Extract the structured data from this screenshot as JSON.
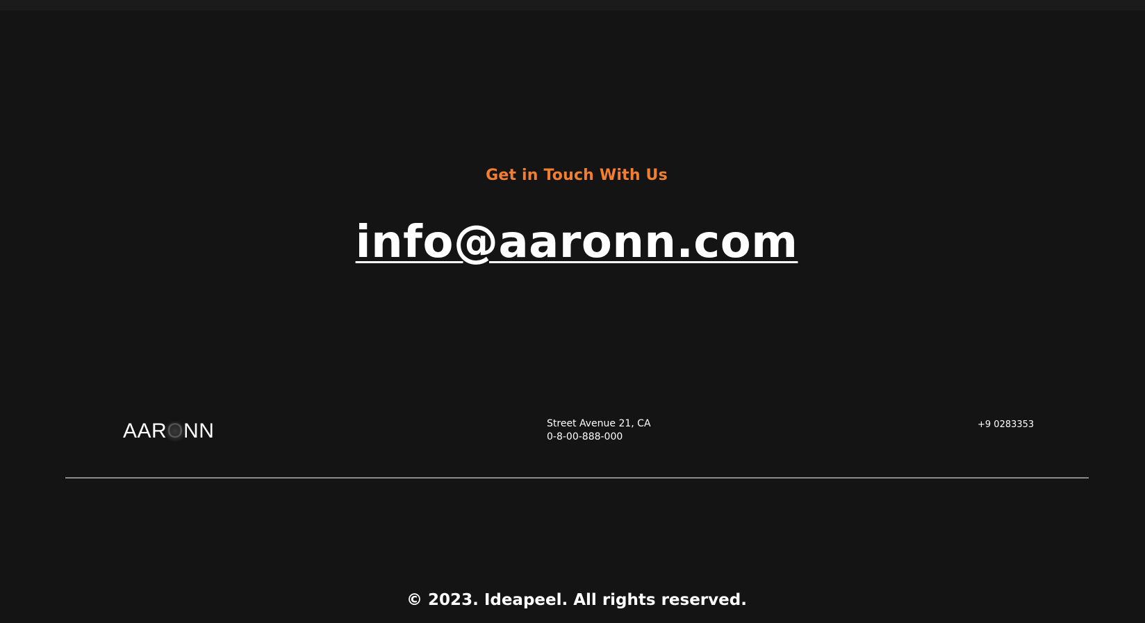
{
  "contact": {
    "heading": "Get in Touch With Us",
    "email": "info@aaronn.com"
  },
  "footer": {
    "logo": {
      "part1": "AAR",
      "part2": "O",
      "part3": "NN"
    },
    "address_line1": "Street Avenue 21, CA",
    "address_line2": "0-8-00-888-000",
    "phone": "+9 0283353",
    "copyright": "© 2023. Ideapeel. All rights reserved."
  },
  "colors": {
    "background": "#141414",
    "accent": "#f27f2f",
    "text": "#ffffff",
    "divider": "#8a8a8a"
  }
}
